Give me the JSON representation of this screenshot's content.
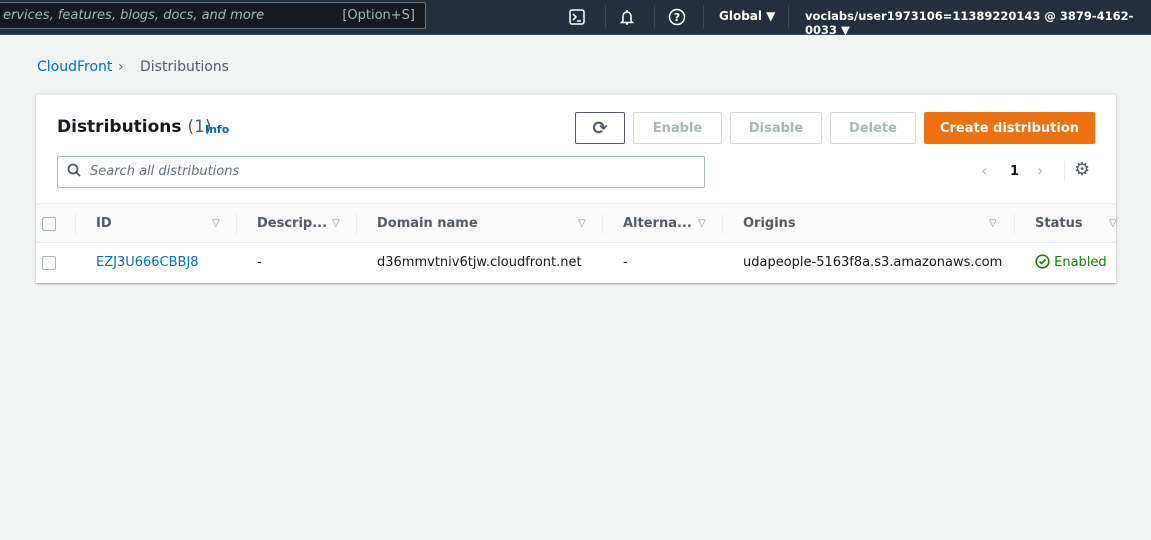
{
  "topbar": {
    "search_placeholder": "ervices, features, blogs, docs, and more",
    "search_shortcut": "[Option+S]",
    "region": "Global ▼",
    "account": "voclabs/user1973106=11389220143 @ 3879-4162-0033 ▼"
  },
  "breadcrumb": {
    "root": "CloudFront",
    "current": "Distributions"
  },
  "panel": {
    "title": "Distributions",
    "count": "(1)",
    "info": "Info",
    "buttons": {
      "enable": "Enable",
      "disable": "Disable",
      "delete": "Delete",
      "create": "Create distribution"
    },
    "search_placeholder": "Search all distributions",
    "page": "1"
  },
  "table": {
    "columns": [
      "ID",
      "Descrip...",
      "Domain name",
      "Alterna...",
      "Origins",
      "Status"
    ],
    "rows": [
      {
        "id": "EZJ3U666CBBJ8",
        "description": "-",
        "domain": "d36mmvtniv6tjw.cloudfront.net",
        "alternate": "-",
        "origins": "udapeople-5163f8a.s3.amazonaws.com",
        "status": "Enabled"
      }
    ]
  },
  "colors": {
    "topbar": "#232f3e",
    "primary": "#ec7211",
    "link": "#0073bb",
    "success": "#1d8102"
  }
}
